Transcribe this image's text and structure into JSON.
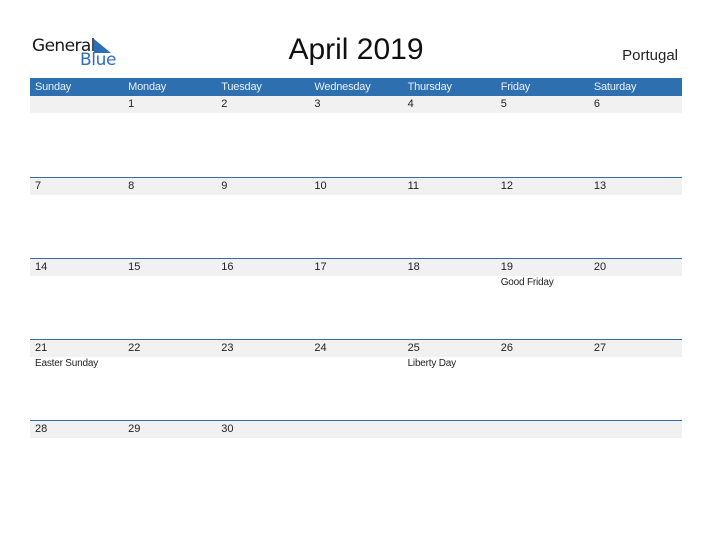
{
  "logo": {
    "line1": "General",
    "line2": "Blue"
  },
  "title": "April 2019",
  "country": "Portugal",
  "weekdays": [
    "Sunday",
    "Monday",
    "Tuesday",
    "Wednesday",
    "Thursday",
    "Friday",
    "Saturday"
  ],
  "weeks": [
    {
      "dates": [
        "",
        "1",
        "2",
        "3",
        "4",
        "5",
        "6"
      ],
      "events": [
        "",
        "",
        "",
        "",
        "",
        "",
        ""
      ]
    },
    {
      "dates": [
        "7",
        "8",
        "9",
        "10",
        "11",
        "12",
        "13"
      ],
      "events": [
        "",
        "",
        "",
        "",
        "",
        "",
        ""
      ]
    },
    {
      "dates": [
        "14",
        "15",
        "16",
        "17",
        "18",
        "19",
        "20"
      ],
      "events": [
        "",
        "",
        "",
        "",
        "",
        "Good Friday",
        ""
      ]
    },
    {
      "dates": [
        "21",
        "22",
        "23",
        "24",
        "25",
        "26",
        "27"
      ],
      "events": [
        "Easter Sunday",
        "",
        "",
        "",
        "Liberty Day",
        "",
        ""
      ]
    },
    {
      "dates": [
        "28",
        "29",
        "30",
        "",
        "",
        "",
        ""
      ],
      "events": [
        "",
        "",
        "",
        "",
        "",
        "",
        ""
      ]
    }
  ],
  "colors": {
    "accent": "#2e6fb0",
    "row_shade": "#f1f1f1"
  }
}
